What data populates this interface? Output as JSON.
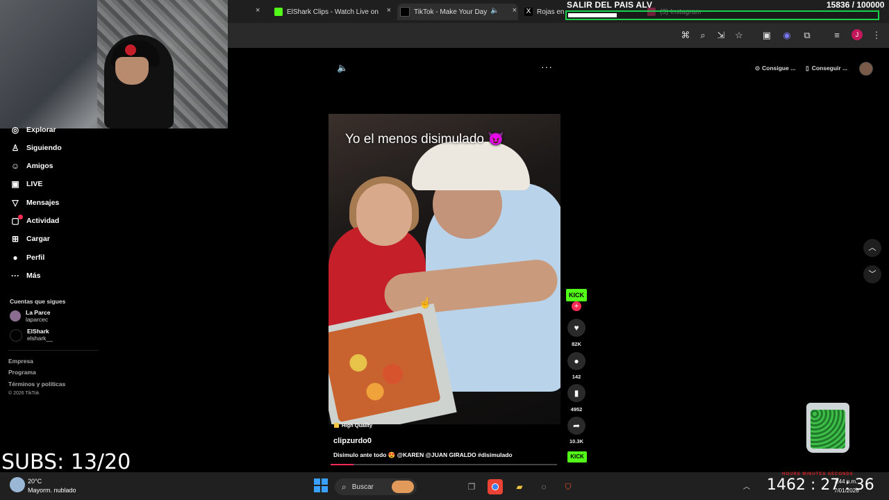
{
  "browser": {
    "tabs": [
      {
        "label": "ElShark Clips - Watch Live on",
        "color": "#53fc18"
      },
      {
        "label": "TikTok - Make Your Day",
        "color": "#ffffff",
        "active": true
      },
      {
        "label": "Rojas en",
        "color": "#ffffff"
      },
      {
        "label": "(3) Instagram",
        "color": "#e1306c"
      }
    ],
    "close_glyph": "×"
  },
  "stream_overlay": {
    "goal_title": "SALIR DEL PAIS ALV",
    "goal_count": "15836 / 100000",
    "goal_progress": 0.158,
    "subs_text": "SUBS: 13/20"
  },
  "sidebar": {
    "items": [
      {
        "label": "Explorar",
        "icon": "compass-icon",
        "glyph": "◎"
      },
      {
        "label": "Siguiendo",
        "icon": "person-icon",
        "glyph": "♙"
      },
      {
        "label": "Amigos",
        "icon": "friends-icon",
        "glyph": "☺"
      },
      {
        "label": "LIVE",
        "icon": "live-icon",
        "glyph": "▣"
      },
      {
        "label": "Mensajes",
        "icon": "send-icon",
        "glyph": "▽"
      },
      {
        "label": "Actividad",
        "icon": "activity-icon",
        "glyph": "▢"
      },
      {
        "label": "Cargar",
        "icon": "upload-icon",
        "glyph": "⊞"
      },
      {
        "label": "Perfil",
        "icon": "profile-icon",
        "glyph": "●"
      },
      {
        "label": "Más",
        "icon": "more-icon",
        "glyph": "···"
      }
    ],
    "following_title": "Cuentas que sigues",
    "following": [
      {
        "name": "La Parce",
        "user": "laparcec"
      },
      {
        "name": "ElShark",
        "user": "elshark__"
      }
    ],
    "footer_links": [
      "Empresa",
      "Programa",
      "Términos y políticas"
    ],
    "copyright": "© 2026 TikTok"
  },
  "header": {
    "get_coins": "Consigue ...",
    "get_app": "Conseguir ..."
  },
  "video": {
    "caption": "Yo el menos disimulado 😈",
    "quality_badge": "High Quality",
    "username": "clipzurdo0",
    "description": "Disimulo ante todo 😍 @KAREN @JUAN GIRALDO #disimulado",
    "progress": 0.1,
    "channel_badge": "KICK",
    "likes": "82K",
    "comments": "142",
    "saves": "4952",
    "shares": "10.3K"
  },
  "taskbar": {
    "temperature": "20°C",
    "weather": "Mayorm. nublado",
    "search_placeholder": "Buscar",
    "timer": "1462 : 27 : 36",
    "timer_labels": "HOURS   MINUTES   SECONDS",
    "time": "7:44 p.m.",
    "date": "7/01/2026"
  }
}
